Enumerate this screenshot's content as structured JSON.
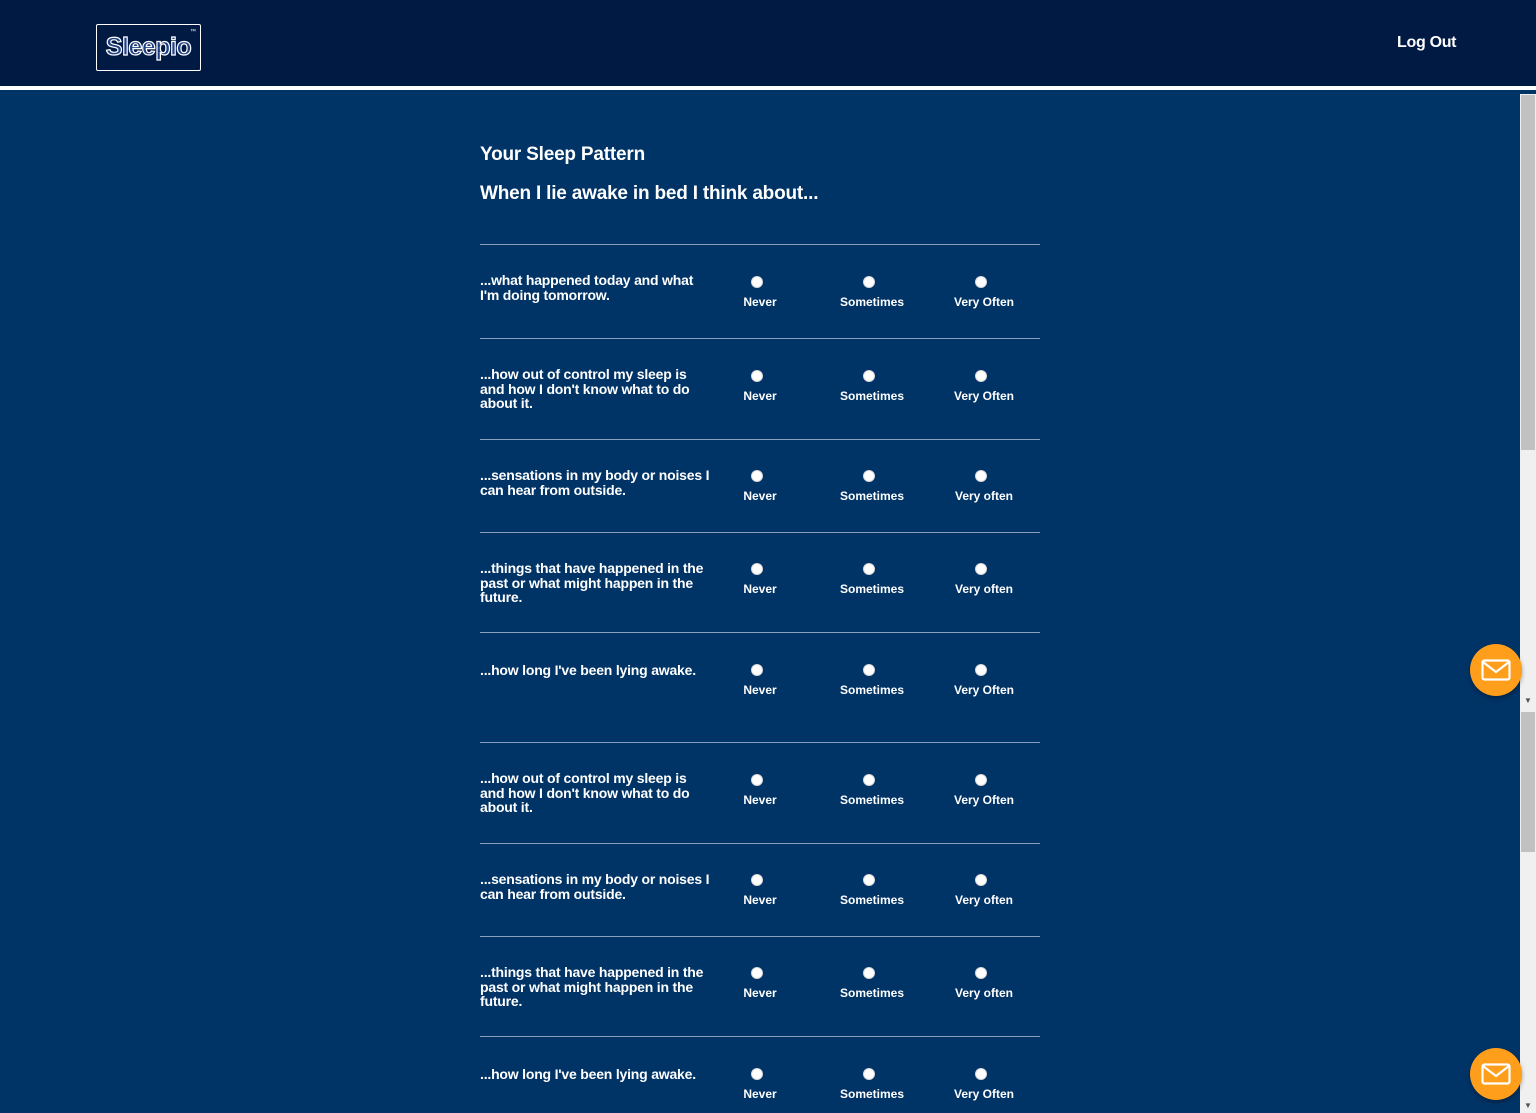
{
  "header": {
    "logo_text": "Sleepio",
    "logout_label": "Log Out"
  },
  "page": {
    "title": "Your Sleep Pattern",
    "subtitle": "When I lie awake in bed I think about..."
  },
  "questions": [
    {
      "text": "...what happened today and what I'm doing tomorrow.",
      "options": [
        "Never",
        "Sometimes",
        "Very Often"
      ]
    },
    {
      "text": "...how out of control my sleep is and how I don't know what to do about it.",
      "options": [
        "Never",
        "Sometimes",
        "Very Often"
      ]
    },
    {
      "text": "...sensations in my body or noises I can hear from outside.",
      "options": [
        "Never",
        "Sometimes",
        "Very often"
      ]
    },
    {
      "text": "...things that have happened in the past or what might happen in the future.",
      "options": [
        "Never",
        "Sometimes",
        "Very often"
      ]
    },
    {
      "text": "...how long I've been lying awake.",
      "options": [
        "Never",
        "Sometimes",
        "Very Often"
      ]
    },
    {
      "text": "...how out of control my sleep is and how I don't know what to do about it.",
      "options": [
        "Never",
        "Sometimes",
        "Very Often"
      ]
    },
    {
      "text": "...sensations in my body or noises I can hear from outside.",
      "options": [
        "Never",
        "Sometimes",
        "Very often"
      ]
    },
    {
      "text": "...things that have happened in the past or what might happen in the future.",
      "options": [
        "Never",
        "Sometimes",
        "Very often"
      ]
    },
    {
      "text": "...how long I've been lying awake.",
      "options": [
        "Never",
        "Sometimes",
        "Very Often"
      ]
    }
  ],
  "icons": {
    "chat": "envelope-icon"
  },
  "colors": {
    "background": "#003366",
    "header": "#001a44",
    "accent": "#ff9e1b"
  }
}
